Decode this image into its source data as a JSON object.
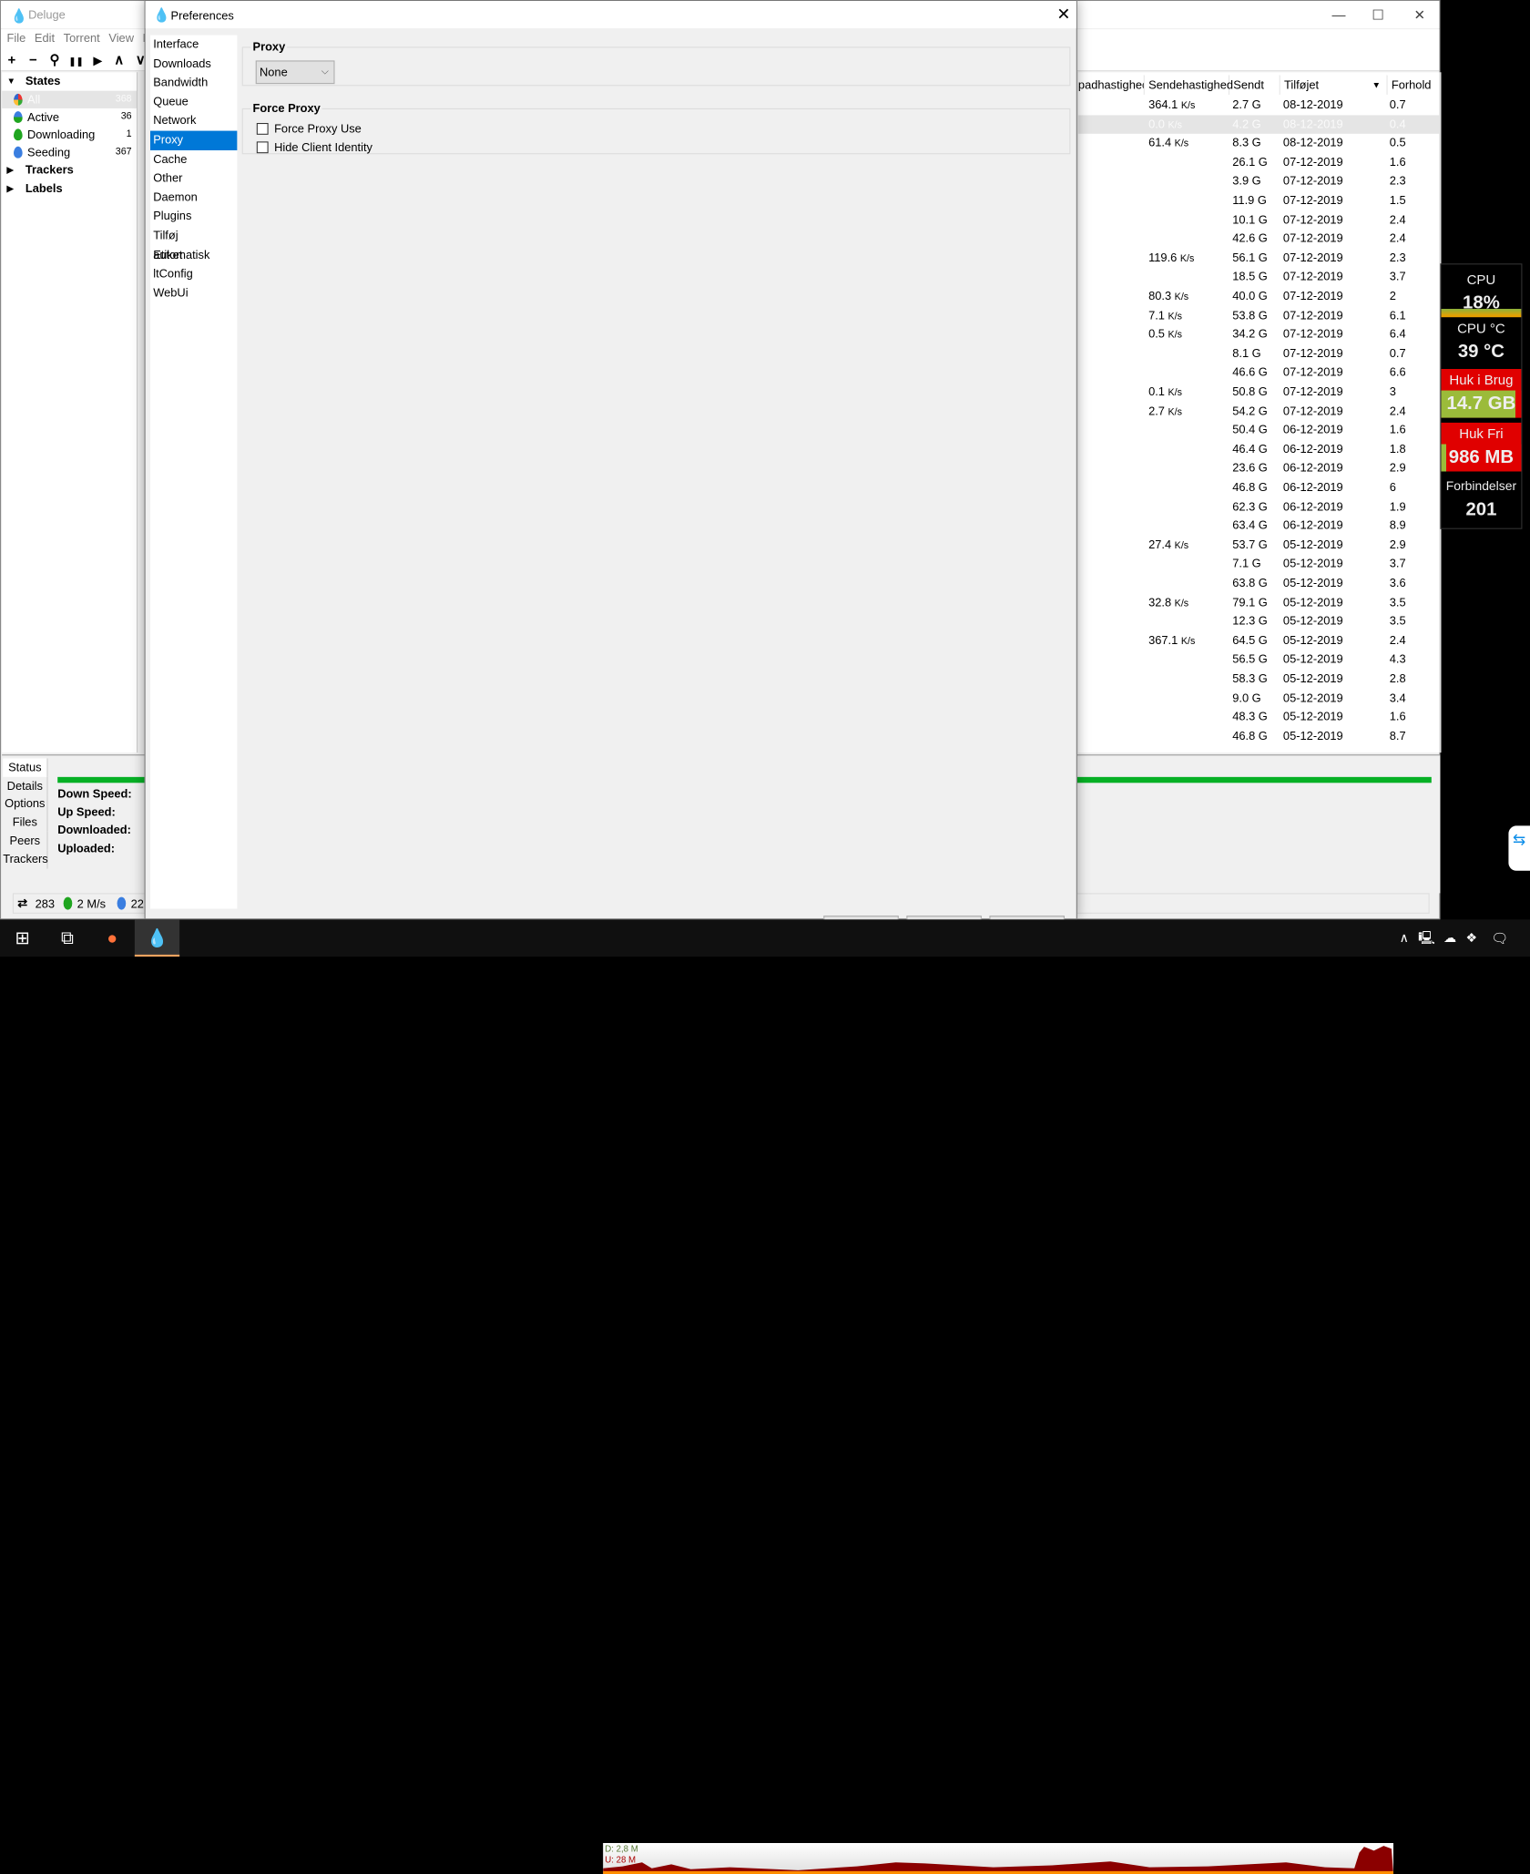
{
  "main": {
    "title": "Deluge",
    "menu": [
      "File",
      "Edit",
      "Torrent",
      "View",
      "H"
    ],
    "toolbar": [
      "+",
      "−",
      "⚲",
      "❚❚",
      "▶",
      "∧",
      "∨"
    ],
    "sidebar": {
      "states_label": "States",
      "items": [
        {
          "label": "All",
          "count": "368"
        },
        {
          "label": "Active",
          "count": "36"
        },
        {
          "label": "Downloading",
          "count": "1"
        },
        {
          "label": "Seeding",
          "count": "367"
        }
      ],
      "trackers_label": "Trackers",
      "labels_label": "Labels"
    },
    "table": {
      "headers": [
        "padhastighed",
        "Sendehastighed",
        "Sendt",
        "Tilføjet",
        "Forhold"
      ],
      "rows": [
        [
          "364.1",
          "2.7 G",
          "08-12-2019",
          "0.7"
        ],
        [
          "0.0",
          "4.2 G",
          "08-12-2019",
          "0.4"
        ],
        [
          "61.4",
          "8.3 G",
          "08-12-2019",
          "0.5"
        ],
        [
          "",
          "26.1 G",
          "07-12-2019",
          "1.6"
        ],
        [
          "",
          "3.9 G",
          "07-12-2019",
          "2.3"
        ],
        [
          "",
          "11.9 G",
          "07-12-2019",
          "1.5"
        ],
        [
          "",
          "10.1 G",
          "07-12-2019",
          "2.4"
        ],
        [
          "",
          "42.6 G",
          "07-12-2019",
          "2.4"
        ],
        [
          "119.6",
          "56.1 G",
          "07-12-2019",
          "2.3"
        ],
        [
          "",
          "18.5 G",
          "07-12-2019",
          "3.7"
        ],
        [
          "80.3",
          "40.0 G",
          "07-12-2019",
          "2"
        ],
        [
          "7.1",
          "53.8 G",
          "07-12-2019",
          "6.1"
        ],
        [
          "0.5",
          "34.2 G",
          "07-12-2019",
          "6.4"
        ],
        [
          "",
          "8.1 G",
          "07-12-2019",
          "0.7"
        ],
        [
          "",
          "46.6 G",
          "07-12-2019",
          "6.6"
        ],
        [
          "0.1",
          "50.8 G",
          "07-12-2019",
          "3"
        ],
        [
          "2.7",
          "54.2 G",
          "07-12-2019",
          "2.4"
        ],
        [
          "",
          "50.4 G",
          "06-12-2019",
          "1.6"
        ],
        [
          "",
          "46.4 G",
          "06-12-2019",
          "1.8"
        ],
        [
          "",
          "23.6 G",
          "06-12-2019",
          "2.9"
        ],
        [
          "",
          "46.8 G",
          "06-12-2019",
          "6"
        ],
        [
          "",
          "62.3 G",
          "06-12-2019",
          "1.9"
        ],
        [
          "",
          "63.4 G",
          "06-12-2019",
          "8.9"
        ],
        [
          "27.4",
          "53.7 G",
          "05-12-2019",
          "2.9"
        ],
        [
          "",
          "7.1 G",
          "05-12-2019",
          "3.7"
        ],
        [
          "",
          "63.8 G",
          "05-12-2019",
          "3.6"
        ],
        [
          "32.8",
          "79.1 G",
          "05-12-2019",
          "3.5"
        ],
        [
          "",
          "12.3 G",
          "05-12-2019",
          "3.5"
        ],
        [
          "367.1",
          "64.5 G",
          "05-12-2019",
          "2.4"
        ],
        [
          "",
          "56.5 G",
          "05-12-2019",
          "4.3"
        ],
        [
          "",
          "58.3 G",
          "05-12-2019",
          "2.8"
        ],
        [
          "",
          "9.0 G",
          "05-12-2019",
          "3.4"
        ],
        [
          "",
          "48.3 G",
          "05-12-2019",
          "1.6"
        ],
        [
          "",
          "46.8 G",
          "05-12-2019",
          "8.7"
        ]
      ],
      "speed_unit": "K/s",
      "selected_row": 1
    },
    "details_tabs": [
      "Status",
      "Details",
      "Options",
      "Files",
      "Peers",
      "Trackers"
    ],
    "status_labels": [
      "Down Speed:",
      "Up Speed:",
      "Downloaded:",
      "Uploaded:"
    ],
    "progress_percent": 100,
    "statusbar": {
      "connections": "283",
      "down": "2 M/s",
      "up": "22"
    }
  },
  "dialog": {
    "title": "Preferences",
    "categories": [
      "Interface",
      "Downloads",
      "Bandwidth",
      "Queue",
      "Network",
      "Proxy",
      "Cache",
      "Other",
      "Daemon",
      "Plugins",
      "Tilføj automatisk",
      "Etiket",
      "ltConfig",
      "WebUi"
    ],
    "selected": "Proxy",
    "proxy_group": "Proxy",
    "proxy_type": "None",
    "force_group": "Force Proxy",
    "force_proxy_use": "Force Proxy Use",
    "hide_identity": "Hide Client Identity",
    "force_proxy_checked": false,
    "hide_identity_checked": false
  },
  "widget": {
    "cpu_label": "CPU",
    "cpu_value": "18%",
    "temp_label": "CPU °C",
    "temp_value": "39 °C",
    "mem_used_label": "Huk i Brug",
    "mem_used_value": "14.7 GB",
    "mem_free_label": "Huk Fri",
    "mem_free_value": "986 MB",
    "conn_label": "Forbindelser",
    "conn_value": "201",
    "colors": {
      "alert": "#e00000",
      "bar": "#9bbb3a"
    }
  },
  "taskbar": {
    "net_down": "D: 2,8 M",
    "net_up": "U: 28 M"
  }
}
